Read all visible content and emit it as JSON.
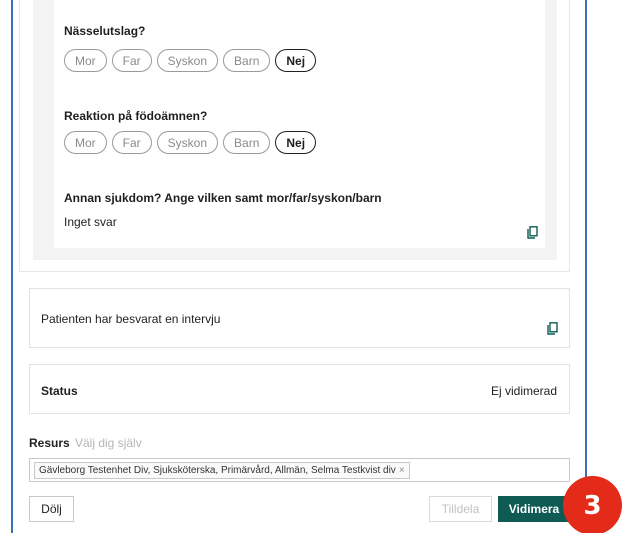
{
  "questions": [
    {
      "title": "Nässelutslag?",
      "options": [
        "Mor",
        "Far",
        "Syskon",
        "Barn",
        "Nej"
      ],
      "selected": "Nej"
    },
    {
      "title": "Reaktion på födoämnen?",
      "options": [
        "Mor",
        "Far",
        "Syskon",
        "Barn",
        "Nej"
      ],
      "selected": "Nej"
    }
  ],
  "free_text_question": {
    "title": "Annan sjukdom? Ange vilken samt mor/far/syskon/barn",
    "answer": "Inget svar"
  },
  "interview_card": {
    "text": "Patienten har besvarat en intervju"
  },
  "status_card": {
    "label": "Status",
    "value": "Ej vidimerad"
  },
  "resurs": {
    "label": "Resurs",
    "hint": "Välj dig själv",
    "selected_tag": "Gävleborg Testenhet Div, Sjuksköterska, Primärvård, Allmän, Selma Testkvist div",
    "remove_glyph": "×"
  },
  "buttons": {
    "hide": "Dölj",
    "assign": "Tilldela",
    "verify": "Vidimera"
  },
  "step_badge": "3",
  "colors": {
    "primary": "#0f5b54",
    "badge": "#e42a18",
    "frame_border": "#3b73b9"
  }
}
